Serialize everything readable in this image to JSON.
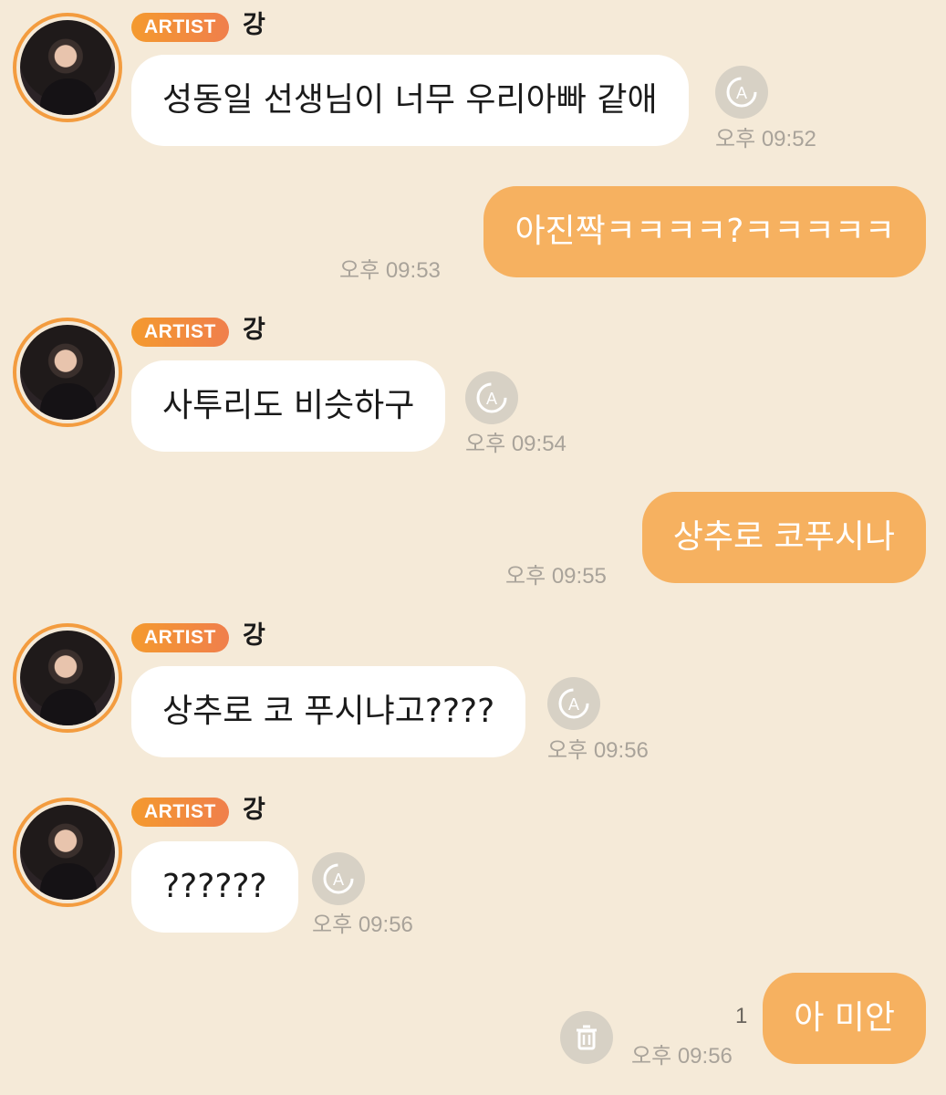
{
  "messages": [
    {
      "dir": "in",
      "badge": "ARTIST",
      "sender": "강",
      "text": "성동일 선생님이 너무 우리아빠 같애",
      "time": "오후 09:52",
      "icon": "translate-icon"
    },
    {
      "dir": "out",
      "text": "아진짝ㅋㅋㅋㅋ?ㅋㅋㅋㅋㅋ",
      "time": "오후 09:53"
    },
    {
      "dir": "in",
      "badge": "ARTIST",
      "sender": "강",
      "text": "사투리도 비슷하구",
      "time": "오후 09:54",
      "icon": "translate-icon"
    },
    {
      "dir": "out",
      "text": "상추로 코푸시나",
      "time": "오후 09:55"
    },
    {
      "dir": "in",
      "badge": "ARTIST",
      "sender": "강",
      "text": "상추로 코 푸시냐고????",
      "time": "오후 09:56",
      "icon": "translate-icon"
    },
    {
      "dir": "in",
      "badge": "ARTIST",
      "sender": "강",
      "text": "??????",
      "time": "오후 09:56",
      "icon": "translate-icon"
    },
    {
      "dir": "out",
      "text": "아 미안",
      "time": "오후 09:56",
      "unread": "1",
      "icon": "trash-icon"
    }
  ],
  "colors": {
    "background": "#f5ead8",
    "outgoing_bubble": "#f6b160",
    "badge": "#f49a2e",
    "avatar_ring": "#f39c3f"
  }
}
